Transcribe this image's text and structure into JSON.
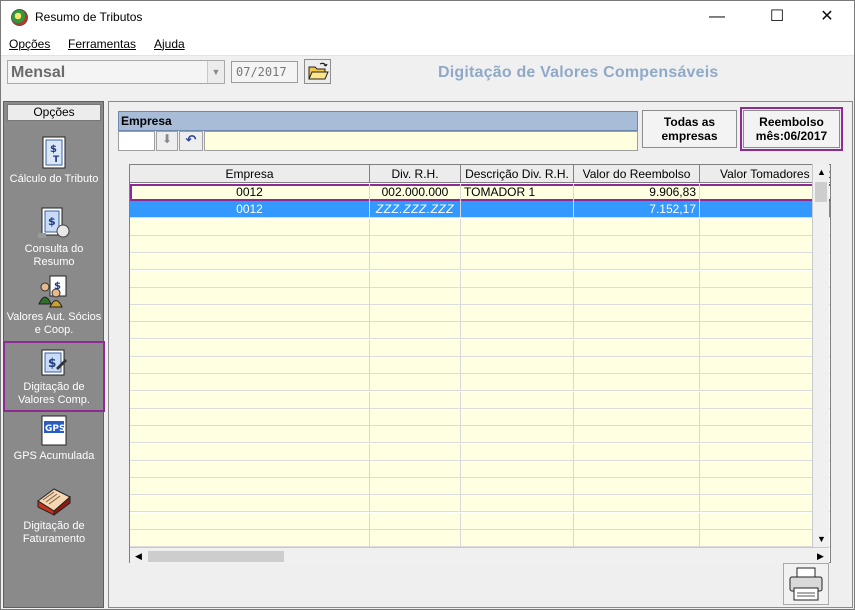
{
  "window": {
    "title": "Resumo de Tributos"
  },
  "menu": {
    "items": [
      "Opções",
      "Ferramentas",
      "Ajuda"
    ]
  },
  "toolbar": {
    "period": "Mensal",
    "date": "07/2017",
    "screen_title": "Digitação de Valores Compensáveis"
  },
  "sidebar": {
    "header": "Opções",
    "items": [
      {
        "label": "Cálculo do Tributo",
        "icon": "calculator-document-icon"
      },
      {
        "label": "Consulta do Resumo",
        "icon": "summary-document-icon"
      },
      {
        "label": "Valores Aut. Sócios e Coop.",
        "icon": "money-people-icon"
      },
      {
        "label": "Digitação de Valores Comp.",
        "icon": "money-edit-icon"
      },
      {
        "label": "GPS Acumulada",
        "icon": "gps-document-icon"
      },
      {
        "label": "Digitação de Faturamento",
        "icon": "invoice-book-icon"
      }
    ]
  },
  "empresa": {
    "label": "Empresa",
    "code": "",
    "name": ""
  },
  "buttons": {
    "todas": "Todas as empresas",
    "reembolso_line1": "Reembolso",
    "reembolso_line2": "mês:06/2017"
  },
  "grid": {
    "columns": [
      "Empresa",
      "Div. R.H.",
      "Descrição Div. R.H.",
      "Valor do Reembolso",
      "Valor Tomadores não"
    ],
    "rows": [
      {
        "empresa": "0012",
        "div": "002.000.000",
        "descricao": "TOMADOR 1",
        "valor": "9.906,83",
        "tomadores": ""
      },
      {
        "empresa": "0012",
        "div": "ZZZ.ZZZ.ZZZ",
        "descricao": "",
        "valor": "7.152,17",
        "tomadores": ""
      }
    ]
  },
  "colors": {
    "highlight": "#8e2a93",
    "selection": "#3399ff",
    "row_bg": "#ffffe1",
    "title_blue": "#8fa9c9"
  }
}
